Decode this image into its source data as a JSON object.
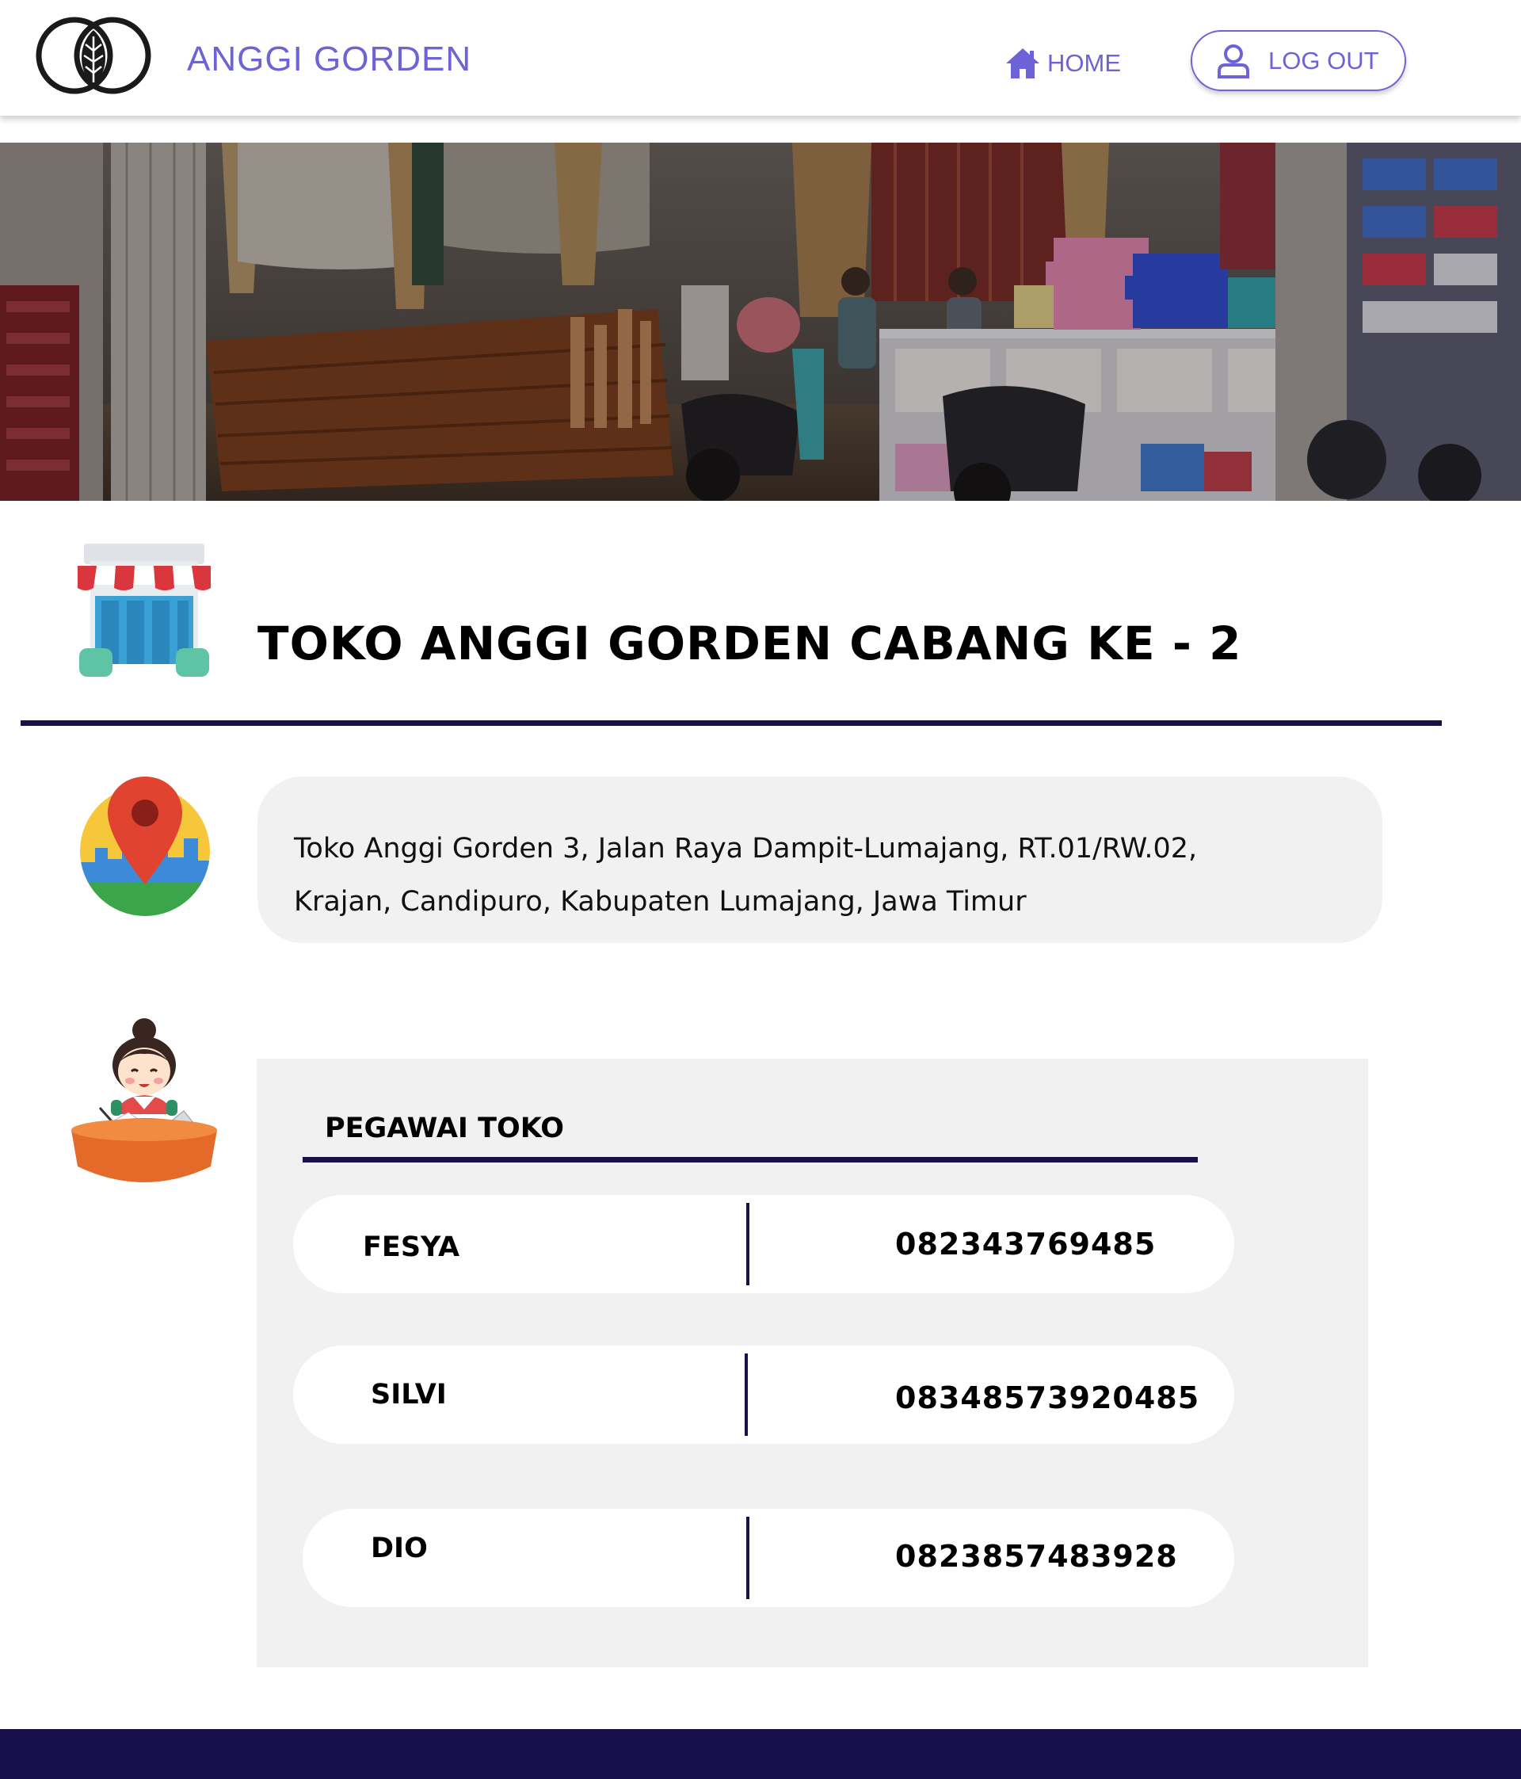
{
  "header": {
    "brand": "ANGGI GORDEN",
    "logo_icon": "leaf-rings-logo",
    "nav": {
      "home_label": "HOME",
      "home_icon": "home-icon"
    },
    "logout": {
      "label": "LOG OUT",
      "icon": "user-icon"
    }
  },
  "hero": {
    "image": "curtain-shop-storefront-photo"
  },
  "store": {
    "title": "TOKO ANGGI GORDEN CABANG KE - 2",
    "icon": "storefront-icon"
  },
  "address": {
    "icon": "map-pin-icon",
    "line1": "Toko Anggi Gorden 3, Jalan Raya Dampit-Lumajang, RT.01/RW.02,",
    "line2": "Krajan, Candipuro, Kabupaten Lumajang, Jawa Timur"
  },
  "employees": {
    "icon": "receptionist-icon",
    "heading": "PEGAWAI TOKO",
    "rows": [
      {
        "name": "FESYA",
        "phone": "082343769485"
      },
      {
        "name": "SILVI",
        "phone": "08348573920485"
      },
      {
        "name": "DIO",
        "phone": "0823857483928"
      }
    ]
  },
  "colors": {
    "accent": "#6d63d6",
    "navy": "#1a1149",
    "footer": "#170f4b",
    "card_bg": "#f2f1f2"
  }
}
